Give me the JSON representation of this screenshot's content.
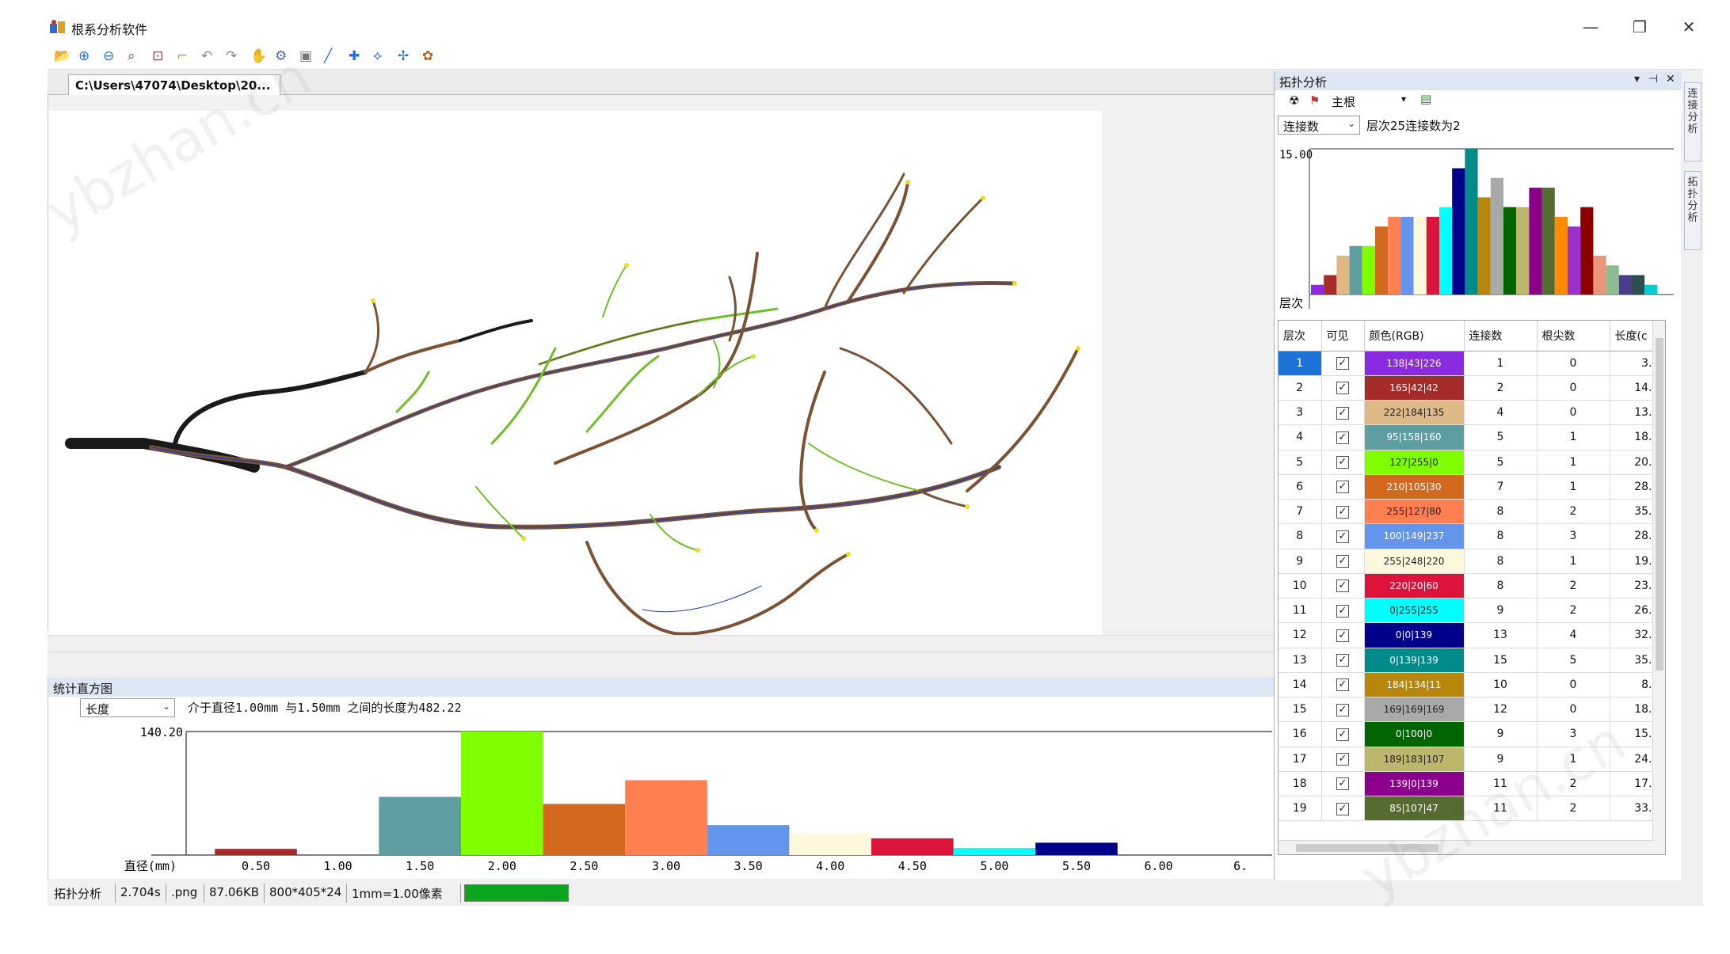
{
  "app": {
    "title": "根系分析软件",
    "window_buttons": {
      "minimize": "—",
      "restore": "❐",
      "close": "✕"
    }
  },
  "toolbar_icons": [
    "open-folder-icon",
    "zoom-in-icon",
    "zoom-out-icon",
    "zoom-icon",
    "fit-window-icon",
    "crop-icon",
    "undo-icon",
    "redo-icon",
    "pan-hand-icon",
    "settings-gear-icon",
    "image-icon",
    "draw-line-icon",
    "add-node-icon",
    "connect-node-icon",
    "split-node-icon",
    "analyze-icon"
  ],
  "document": {
    "tab_title": "C:\\Users\\47074\\Desktop\\20..."
  },
  "histogram": {
    "title": "统计直方图",
    "select_value": "长度",
    "info": "介于直径1.00mm 与1.50mm 之间的长度为482.22",
    "ymax_label": "140.20",
    "x_title": "直径(mm)"
  },
  "topology": {
    "title": "拓扑分析",
    "root_select": "主根",
    "metric_select": "连接数",
    "info": "层次25连接数为2",
    "ymax_label": "15.00",
    "x_title": "层次",
    "columns": [
      "层次",
      "可见",
      "颜色(RGB)",
      "连接数",
      "根尖数",
      "长度(c"
    ],
    "rows": [
      {
        "level": "1",
        "color_label": "138|43|226",
        "color": "#8a2be2",
        "links": "1",
        "tips": "0",
        "length": "3."
      },
      {
        "level": "2",
        "color_label": "165|42|42",
        "color": "#a52a2a",
        "links": "2",
        "tips": "0",
        "length": "14."
      },
      {
        "level": "3",
        "color_label": "222|184|135",
        "color": "#deb887",
        "links": "4",
        "tips": "0",
        "length": "13."
      },
      {
        "level": "4",
        "color_label": "95|158|160",
        "color": "#5f9ea0",
        "links": "5",
        "tips": "1",
        "length": "18."
      },
      {
        "level": "5",
        "color_label": "127|255|0",
        "color": "#7fff00",
        "links": "5",
        "tips": "1",
        "length": "20."
      },
      {
        "level": "6",
        "color_label": "210|105|30",
        "color": "#d2691e",
        "links": "7",
        "tips": "1",
        "length": "28."
      },
      {
        "level": "7",
        "color_label": "255|127|80",
        "color": "#ff7f50",
        "links": "8",
        "tips": "2",
        "length": "35."
      },
      {
        "level": "8",
        "color_label": "100|149|237",
        "color": "#6495ed",
        "links": "8",
        "tips": "3",
        "length": "28."
      },
      {
        "level": "9",
        "color_label": "255|248|220",
        "color": "#fff8dc",
        "links": "8",
        "tips": "1",
        "length": "19."
      },
      {
        "level": "10",
        "color_label": "220|20|60",
        "color": "#dc143c",
        "links": "8",
        "tips": "2",
        "length": "23."
      },
      {
        "level": "11",
        "color_label": "0|255|255",
        "color": "#00ffff",
        "links": "9",
        "tips": "2",
        "length": "26."
      },
      {
        "level": "12",
        "color_label": "0|0|139",
        "color": "#00008b",
        "links": "13",
        "tips": "4",
        "length": "32."
      },
      {
        "level": "13",
        "color_label": "0|139|139",
        "color": "#008b8b",
        "links": "15",
        "tips": "5",
        "length": "35."
      },
      {
        "level": "14",
        "color_label": "184|134|11",
        "color": "#b8860b",
        "links": "10",
        "tips": "0",
        "length": "8."
      },
      {
        "level": "15",
        "color_label": "169|169|169",
        "color": "#a9a9a9",
        "links": "12",
        "tips": "0",
        "length": "18."
      },
      {
        "level": "16",
        "color_label": "0|100|0",
        "color": "#006400",
        "links": "9",
        "tips": "3",
        "length": "15."
      },
      {
        "level": "17",
        "color_label": "189|183|107",
        "color": "#bdb76b",
        "links": "9",
        "tips": "1",
        "length": "24."
      },
      {
        "level": "18",
        "color_label": "139|0|139",
        "color": "#8b008b",
        "links": "11",
        "tips": "2",
        "length": "17."
      },
      {
        "level": "19",
        "color_label": "85|107|47",
        "color": "#556b2f",
        "links": "11",
        "tips": "2",
        "length": "33."
      }
    ]
  },
  "side_tabs": [
    "连接分析",
    "拓扑分析"
  ],
  "status": {
    "mode": "拓扑分析",
    "time": "2.704s",
    "ext": ".png",
    "size": "87.06KB",
    "dims": "800*405*24",
    "scale": "1mm=1.00像素"
  },
  "watermark": "ybzhan.cn",
  "chart_data": [
    {
      "type": "bar",
      "title": "统计直方图",
      "xlabel": "直径(mm)",
      "ylabel": "",
      "ylim": [
        0,
        140.2
      ],
      "x_ticks": [
        "0.50",
        "1.00",
        "1.50",
        "2.00",
        "2.50",
        "3.00",
        "3.50",
        "4.00",
        "4.50",
        "5.00",
        "5.50",
        "6.00",
        "6."
      ],
      "bins": [
        [
          0.25,
          0.75
        ],
        [
          0.75,
          1.25
        ],
        [
          1.25,
          1.75
        ],
        [
          1.75,
          2.25
        ],
        [
          2.25,
          2.75
        ],
        [
          2.75,
          3.25
        ],
        [
          3.25,
          3.75
        ],
        [
          3.75,
          4.25
        ],
        [
          4.25,
          4.75
        ],
        [
          4.75,
          5.25
        ],
        [
          5.25,
          5.75
        ]
      ],
      "values": [
        7,
        0,
        66,
        140.2,
        58,
        85,
        34,
        25,
        19,
        8,
        14
      ],
      "colors": [
        "#a52a2a",
        "#deb887",
        "#5f9ea0",
        "#7fff00",
        "#d2691e",
        "#ff7f50",
        "#6495ed",
        "#fff8dc",
        "#dc143c",
        "#00ffff",
        "#00008b"
      ]
    },
    {
      "type": "bar",
      "title": "",
      "xlabel": "层次",
      "ylabel": "",
      "ylim": [
        0,
        15
      ],
      "categories": [
        "1",
        "2",
        "3",
        "4",
        "5",
        "6",
        "7",
        "8",
        "9",
        "10",
        "11",
        "12",
        "13",
        "14",
        "15",
        "16",
        "17",
        "18",
        "19",
        "20",
        "21",
        "22",
        "23",
        "24",
        "25",
        "26",
        "27"
      ],
      "values": [
        1,
        2,
        4,
        5,
        5,
        7,
        8,
        8,
        8,
        8,
        9,
        13,
        15,
        10,
        12,
        9,
        9,
        11,
        11,
        8,
        7,
        9,
        4,
        3,
        2,
        2,
        1
      ],
      "colors": [
        "#8a2be2",
        "#a52a2a",
        "#deb887",
        "#5f9ea0",
        "#7fff00",
        "#d2691e",
        "#ff7f50",
        "#6495ed",
        "#fff8dc",
        "#dc143c",
        "#00ffff",
        "#00008b",
        "#008b8b",
        "#b8860b",
        "#a9a9a9",
        "#006400",
        "#bdb76b",
        "#8b008b",
        "#556b2f",
        "#ff8c00",
        "#9932cc",
        "#8b0000",
        "#e9967a",
        "#8fbc8f",
        "#483d8b",
        "#2f4f4f",
        "#00ced1"
      ]
    }
  ]
}
